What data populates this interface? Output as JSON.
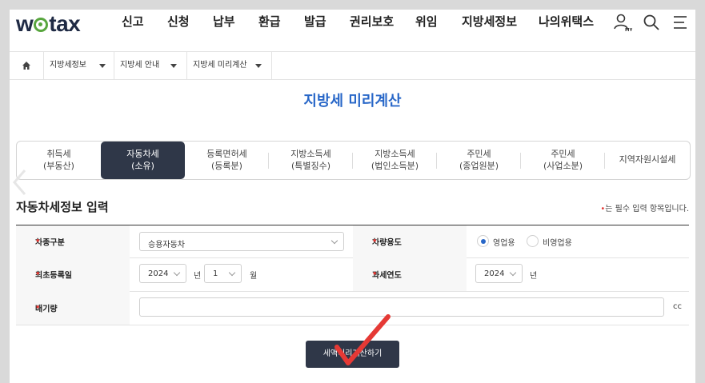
{
  "header": {
    "logo": "wetax",
    "logo_prefix": "w",
    "logo_suffix": "tax",
    "menu": [
      "신고",
      "신청",
      "납부",
      "환급",
      "발급",
      "권리보호",
      "위임",
      "지방세정보",
      "나의위택스"
    ],
    "icons": [
      "user-my-icon",
      "search-icon",
      "hamburger-menu-icon"
    ],
    "my_badge": "MY"
  },
  "breadcrumb": {
    "home_icon": "home-icon",
    "items": [
      "지방세정보",
      "지방세 안내",
      "지방세 미리계산"
    ]
  },
  "page_title": "지방세 미리계산",
  "tabs": [
    {
      "line1": "취득세",
      "line2": "(부동산)",
      "active": false
    },
    {
      "line1": "자동차세",
      "line2": "(소유)",
      "active": true
    },
    {
      "line1": "등록면허세",
      "line2": "(등록분)",
      "active": false
    },
    {
      "line1": "지방소득세",
      "line2": "(특별징수)",
      "active": false
    },
    {
      "line1": "지방소득세",
      "line2": "(법인소득분)",
      "active": false
    },
    {
      "line1": "주민세",
      "line2": "(종업원분)",
      "active": false
    },
    {
      "line1": "주민세",
      "line2": "(사업소분)",
      "active": false
    },
    {
      "line1": "지역자원시설세",
      "line2": "",
      "active": false
    }
  ],
  "form": {
    "section_title": "자동차세정보 입력",
    "required_mark": "•",
    "required_note": "는 필수 입력 항목입니다.",
    "vehicle_type": {
      "label": "차종구분",
      "value": "승용자동차"
    },
    "vehicle_use": {
      "label": "차량용도",
      "options": [
        "영업용",
        "비영업용"
      ],
      "selected": "영업용"
    },
    "first_reg": {
      "label": "최초등록일",
      "year": "2024",
      "year_unit": "년",
      "month": "1",
      "month_unit": "월"
    },
    "tax_year": {
      "label": "과세연도",
      "year": "2024",
      "unit": "년"
    },
    "displacement": {
      "label": "배기량",
      "value": "",
      "unit": "cc"
    }
  },
  "submit_button": "세액미리계산하기",
  "colors": {
    "accent": "#2867c8",
    "dark": "#2f3748",
    "required": "#e53935",
    "logo_green": "#58a63e",
    "annotation": "#e53935"
  }
}
